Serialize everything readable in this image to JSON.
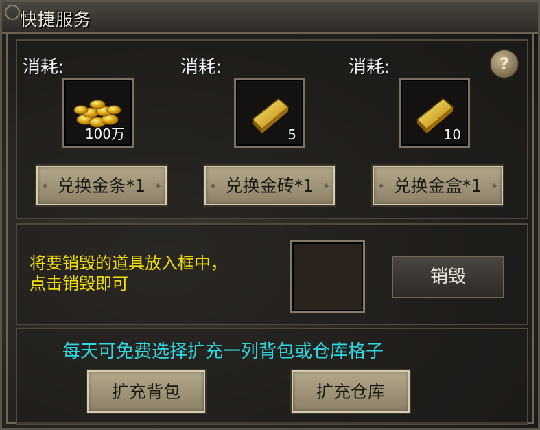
{
  "window": {
    "title": "快捷服务",
    "help_label": "?"
  },
  "exchange": {
    "items": [
      {
        "cost_label": "消耗:",
        "item_icon": "gold-coins-icon",
        "quantity": "100万",
        "button_label": "兑换金条*1"
      },
      {
        "cost_label": "消耗:",
        "item_icon": "gold-bar-icon",
        "quantity": "5",
        "button_label": "兑换金砖*1"
      },
      {
        "cost_label": "消耗:",
        "item_icon": "gold-bar-icon",
        "quantity": "10",
        "button_label": "兑换金盒*1"
      }
    ]
  },
  "destroy": {
    "instruction": "将要销毁的道具放入框中，\n点击销毁即可",
    "button_label": "销毁"
  },
  "expand": {
    "info": "每天可免费选择扩充一列背包或仓库格子",
    "bag_button_label": "扩充背包",
    "warehouse_button_label": "扩充仓库"
  },
  "colors": {
    "instruction_text": "#f2e000",
    "info_text": "#2ed8e0"
  }
}
